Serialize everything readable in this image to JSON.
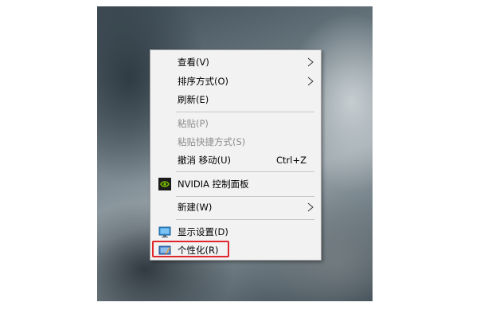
{
  "context_menu": {
    "items": [
      {
        "name": "view",
        "label": "查看(V)",
        "submenu": true
      },
      {
        "name": "sort-by",
        "label": "排序方式(O)",
        "submenu": true
      },
      {
        "name": "refresh",
        "label": "刷新(E)"
      },
      {
        "name": "paste",
        "label": "粘贴(P)",
        "disabled": true
      },
      {
        "name": "paste-shortcut",
        "label": "粘贴快捷方式(S)",
        "disabled": true
      },
      {
        "name": "undo-move",
        "label": "撤消 移动(U)",
        "shortcut": "Ctrl+Z"
      },
      {
        "name": "nvidia-control-panel",
        "label": "NVIDIA 控制面板",
        "icon": "nvidia-icon"
      },
      {
        "name": "new",
        "label": "新建(W)",
        "submenu": true
      },
      {
        "name": "display-settings",
        "label": "显示设置(D)",
        "icon": "display-icon"
      },
      {
        "name": "personalize",
        "label": "个性化(R)",
        "icon": "personalize-icon",
        "highlighted": true
      }
    ]
  },
  "colors": {
    "menu_background": "#f2f2f2",
    "disabled_text": "#8d8d8d",
    "highlight_border": "#e0272c",
    "nvidia_green": "#76b900"
  }
}
